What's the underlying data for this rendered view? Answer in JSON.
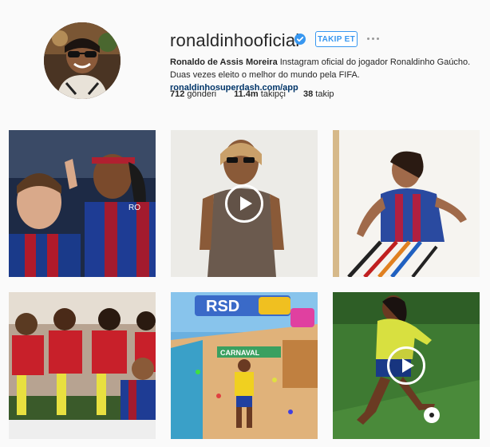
{
  "profile": {
    "username": "ronaldinhooficial",
    "follow_label": "TAKIP ET",
    "full_name": "Ronaldo de Assis Moreira",
    "bio_text": " Instagram oficial do jogador Ronaldinho Gaúcho. Duas vezes eleito o melhor do mundo pela FIFA. ",
    "link": "ronaldinhosuperdash.com/app"
  },
  "stats": [
    {
      "count": "712",
      "label": "gönderi"
    },
    {
      "count": "11.4m",
      "label": "takipçi"
    },
    {
      "count": "38",
      "label": "takip"
    }
  ],
  "icons": {
    "verified": "verified-badge-icon",
    "more": "more-options-icon",
    "play": "play-icon"
  },
  "colors": {
    "accent": "#3897f0",
    "link": "#003569",
    "background": "#fafafa"
  },
  "posts": {
    "banner_text": "RSD",
    "carnaval_text": "CARNAVAL"
  }
}
